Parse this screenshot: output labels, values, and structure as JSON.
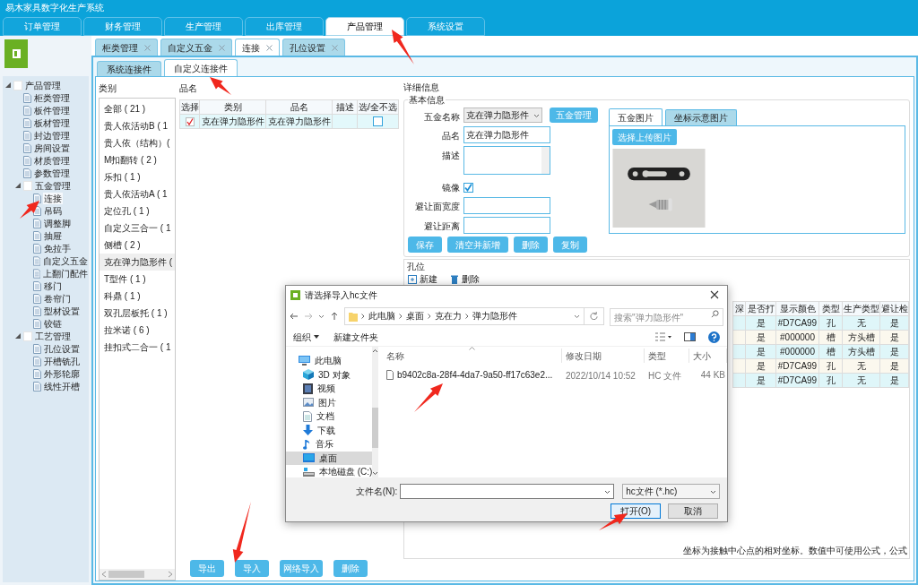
{
  "app_title": "易木家具数字化生产系统",
  "main_tabs": [
    {
      "label": "订单管理",
      "selected": false
    },
    {
      "label": "财务管理",
      "selected": false
    },
    {
      "label": "生产管理",
      "selected": false
    },
    {
      "label": "出库管理",
      "selected": false
    },
    {
      "label": "产品管理",
      "selected": true
    },
    {
      "label": "系统设置",
      "selected": false
    }
  ],
  "sidebar_tree": [
    {
      "label": "产品管理",
      "expanded": true,
      "selected": false,
      "children": [
        {
          "label": "柜类管理",
          "selected": false
        },
        {
          "label": "板件管理",
          "selected": false
        },
        {
          "label": "板材管理",
          "selected": false
        },
        {
          "label": "封边管理",
          "selected": false
        },
        {
          "label": "房间设置",
          "selected": false
        },
        {
          "label": "材质管理",
          "selected": false
        },
        {
          "label": "参数管理",
          "selected": false
        },
        {
          "label": "五金管理",
          "expanded": true,
          "selected": false,
          "children": [
            {
              "label": "连接",
              "selected": true
            },
            {
              "label": "吊码",
              "selected": false
            },
            {
              "label": "调整脚",
              "selected": false
            },
            {
              "label": "抽屉",
              "selected": false
            },
            {
              "label": "免拉手",
              "selected": false
            },
            {
              "label": "自定义五金",
              "selected": false
            },
            {
              "label": "上翻门配件",
              "selected": false
            },
            {
              "label": "移门",
              "selected": false
            },
            {
              "label": "卷帘门",
              "selected": false
            },
            {
              "label": "型材设置",
              "selected": false
            },
            {
              "label": "铰链",
              "selected": false
            }
          ]
        },
        {
          "label": "工艺管理",
          "expanded": true,
          "selected": false,
          "children": [
            {
              "label": "孔位设置",
              "selected": false
            },
            {
              "label": "开槽铣孔",
              "selected": false
            },
            {
              "label": "外形轮廓",
              "selected": false
            },
            {
              "label": "线性开槽",
              "selected": false
            }
          ]
        }
      ]
    }
  ],
  "page_tabs": [
    {
      "label": "柜类管理",
      "selected": false
    },
    {
      "label": "自定义五金",
      "selected": false
    },
    {
      "label": "连接",
      "selected": true
    },
    {
      "label": "孔位设置",
      "selected": false
    }
  ],
  "sub_tabs": [
    {
      "label": "系统连接件",
      "selected": false
    },
    {
      "label": "自定义连接件",
      "selected": true
    }
  ],
  "category_panel": {
    "title": "类别",
    "items": [
      {
        "label": "全部 ( 21 )",
        "selected": false
      },
      {
        "label": "贵人依活动B ( 1",
        "selected": false
      },
      {
        "label": "贵人依（结构）(",
        "selected": false
      },
      {
        "label": "M扣翻转 ( 2 )",
        "selected": false
      },
      {
        "label": "乐扣 ( 1 )",
        "selected": false
      },
      {
        "label": "贵人依活动A ( 1",
        "selected": false
      },
      {
        "label": "定位孔 ( 1 )",
        "selected": false
      },
      {
        "label": "自定义三合一 ( 1",
        "selected": false
      },
      {
        "label": "侧槽 ( 2 )",
        "selected": false
      },
      {
        "label": "克在弹力隐形件 (",
        "selected": true
      },
      {
        "label": "T型件 ( 1 )",
        "selected": false
      },
      {
        "label": "科鼎 ( 1 )",
        "selected": false
      },
      {
        "label": "双孔层板托 ( 1 )",
        "selected": false
      },
      {
        "label": "拉米诺 ( 6 )",
        "selected": false
      },
      {
        "label": "挂扣式二合一 ( 1",
        "selected": false
      }
    ]
  },
  "product_panel": {
    "title": "品名",
    "columns": [
      "选择",
      "类别",
      "品名",
      "描述",
      "选/全不选"
    ],
    "rows": [
      {
        "checked": true,
        "category": "克在弹力隐形件",
        "name": "克在弹力隐形件",
        "included": false
      }
    ]
  },
  "bottom_buttons": [
    "导出",
    "导入",
    "网络导入",
    "删除"
  ],
  "details": {
    "title": "详细信息",
    "section": "基本信息",
    "hardware_name": {
      "label": "五金名称",
      "value": "克在弹力隐形件"
    },
    "manage_button": "五金管理",
    "name": {
      "label": "品名",
      "value": "克在弹力隐形件"
    },
    "description": {
      "label": "描述"
    },
    "mirror": {
      "label": "镜像",
      "checked": true
    },
    "avoid_width": {
      "label": "避让面宽度"
    },
    "avoid_distance": {
      "label": "避让距离"
    },
    "buttons": [
      "保存",
      "清空并新增",
      "删除",
      "复制"
    ],
    "image_tabs": [
      {
        "label": "五金图片",
        "selected": true
      },
      {
        "label": "坐标示意图片",
        "selected": false
      }
    ],
    "upload_button": "选择上传图片",
    "photo": {
      "kind": "picture"
    }
  },
  "holes": {
    "title": "孔位",
    "toolbar": [
      "新建",
      "删除"
    ],
    "columns": [
      "深",
      "是否打",
      "显示颜色",
      "类型",
      "生产类型",
      "避让检"
    ],
    "rows": [
      {
        "cells": [
          "",
          "是",
          "#D7CA99",
          "孔",
          "无",
          "是"
        ]
      },
      {
        "cells": [
          "",
          "是",
          "#000000",
          "槽",
          "方头槽",
          "是"
        ]
      },
      {
        "cells": [
          "",
          "是",
          "#000000",
          "槽",
          "方头槽",
          "是"
        ]
      },
      {
        "cells": [
          "",
          "是",
          "#D7CA99",
          "孔",
          "无",
          "是"
        ]
      },
      {
        "cells": [
          "",
          "是",
          "#D7CA99",
          "孔",
          "无",
          "是"
        ]
      }
    ],
    "note": "坐标为接触中心点的相对坐标。数值中可使用公式，公式"
  },
  "file_dialog": {
    "title": "请选择导入hc文件",
    "path": [
      "此电脑",
      "桌面",
      "克在力",
      "弹力隐形件"
    ],
    "search_placeholder": "搜索\"弹力隐形件\"",
    "toolbar": [
      "组织",
      "新建文件夹"
    ],
    "nav": [
      {
        "kind": "pc",
        "label": "此电脑",
        "selected": false
      },
      {
        "kind": "objects",
        "label": "3D 对象",
        "selected": false
      },
      {
        "kind": "video",
        "label": "视频",
        "selected": false
      },
      {
        "kind": "pictures",
        "label": "图片",
        "selected": false
      },
      {
        "kind": "docs",
        "label": "文档",
        "selected": false
      },
      {
        "kind": "download",
        "label": "下载",
        "selected": false
      },
      {
        "kind": "music",
        "label": "音乐",
        "selected": false
      },
      {
        "kind": "desktop",
        "label": "桌面",
        "selected": true
      },
      {
        "kind": "drive",
        "label": "本地磁盘 (C:)",
        "selected": false
      }
    ],
    "columns": [
      "名称",
      "修改日期",
      "类型",
      "大小"
    ],
    "files": [
      {
        "name": "b9402c8a-28f4-4da7-9a50-ff17c63e2...",
        "date": "2022/10/14 10:52",
        "type": "HC 文件",
        "size": "44 KB"
      }
    ],
    "filename_label": "文件名(N):",
    "filter": "hc文件 (*.hc)",
    "buttons": [
      "打开(O)",
      "取消"
    ]
  }
}
